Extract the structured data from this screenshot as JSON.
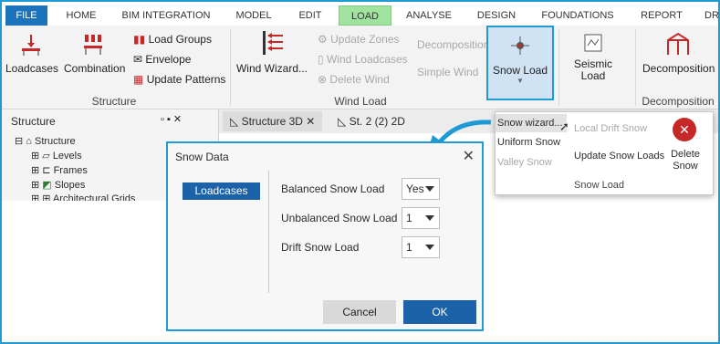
{
  "menu": [
    "FILE",
    "HOME",
    "BIM INTEGRATION",
    "MODEL",
    "EDIT",
    "LOAD",
    "ANALYSE",
    "DESIGN",
    "FOUNDATIONS",
    "REPORT",
    "DR"
  ],
  "ribbon": {
    "structure": {
      "loadcases": "Loadcases",
      "combination": "Combination",
      "load_groups": "Load Groups",
      "envelope": "Envelope",
      "update_patterns": "Update Patterns",
      "group_label": "Structure"
    },
    "wind": {
      "wizard": "Wind Wizard...",
      "update_zones": "Update Zones",
      "wind_loadcases": "Wind Loadcases",
      "delete_wind": "Delete Wind",
      "decomposition": "Decomposition",
      "simple_wind": "Simple Wind",
      "group_label": "Wind Load"
    },
    "snow": {
      "label": "Snow Load"
    },
    "seismic": {
      "label": "Seismic Load"
    },
    "decomp": {
      "label": "Decomposition",
      "group_label": "Decomposition"
    }
  },
  "panel": {
    "title": "Structure",
    "tree": [
      "Structure",
      "Levels",
      "Frames",
      "Slopes",
      "Architectural Grids"
    ]
  },
  "views": {
    "tab1": "Structure 3D",
    "tab2": "St. 2 (2) 2D"
  },
  "dropdown": {
    "snow_wizard": "Snow wizard...",
    "local_drift": "Local Drift Snow",
    "uniform": "Uniform Snow",
    "valley": "Valley Snow",
    "update_snow": "Update Snow Loads",
    "delete": "Delete Snow",
    "group_label": "Snow Load"
  },
  "dialog": {
    "title": "Snow Data",
    "side": "Loadcases",
    "rows": [
      {
        "label": "Balanced Snow Load",
        "value": "Yes"
      },
      {
        "label": "Unbalanced Snow Load",
        "value": "1"
      },
      {
        "label": "Drift Snow Load",
        "value": "1"
      }
    ],
    "cancel": "Cancel",
    "ok": "OK"
  },
  "colors": {
    "accent": "#1e9bd4",
    "active_tab": "#9fe39f",
    "primary": "#1b62a8"
  }
}
